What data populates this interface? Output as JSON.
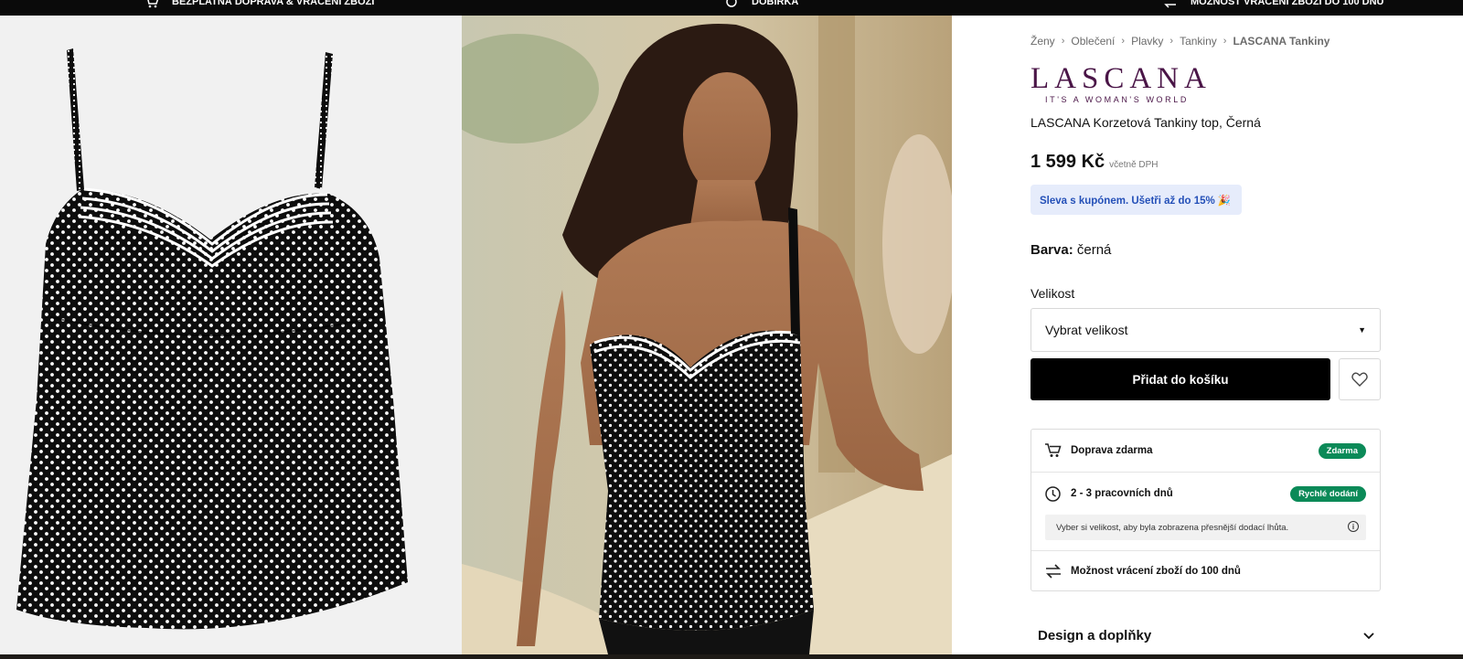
{
  "topbar": {
    "shipping": "BEZPLATNÁ DOPRAVA & VRÁCENÍ ZBOŽÍ",
    "cod": "DOBÍRKA",
    "returns": "MOŽNOST VRÁCENÍ ZBOŽÍ DO 100 DNŮ"
  },
  "breadcrumb": [
    "Ženy",
    "Oblečení",
    "Plavky",
    "Tankiny",
    "LASCANA Tankiny"
  ],
  "brand": {
    "name": "LASCANA",
    "tagline": "IT'S A WOMAN'S WORLD"
  },
  "product": {
    "title": "LASCANA Korzetová Tankiny top, Černá",
    "price": "1 599 Kč",
    "vat": "včetně DPH",
    "coupon": "Sleva s kupónem. Ušetři až do 15% 🎉",
    "color_label": "Barva:",
    "color_value": "černá",
    "size_label": "Velikost",
    "size_placeholder": "Vybrat velikost",
    "add_to_cart": "Přidat do košíku"
  },
  "delivery": {
    "free_shipping": "Doprava zdarma",
    "free_badge": "Zdarma",
    "days": "2 - 3 pracovních dnů",
    "fast_badge": "Rychlé dodání",
    "note": "Vyber si velikost, aby byla zobrazena přesnější dodací lhůta.",
    "returns": "Možnost vrácení zboží do 100 dnů"
  },
  "accordion": {
    "design": "Design a doplňky"
  },
  "colors": {
    "brand": "#4a1547",
    "badge": "#0b8a58",
    "coupon_text": "#2450b8",
    "coupon_bg": "#e6ecfb"
  }
}
